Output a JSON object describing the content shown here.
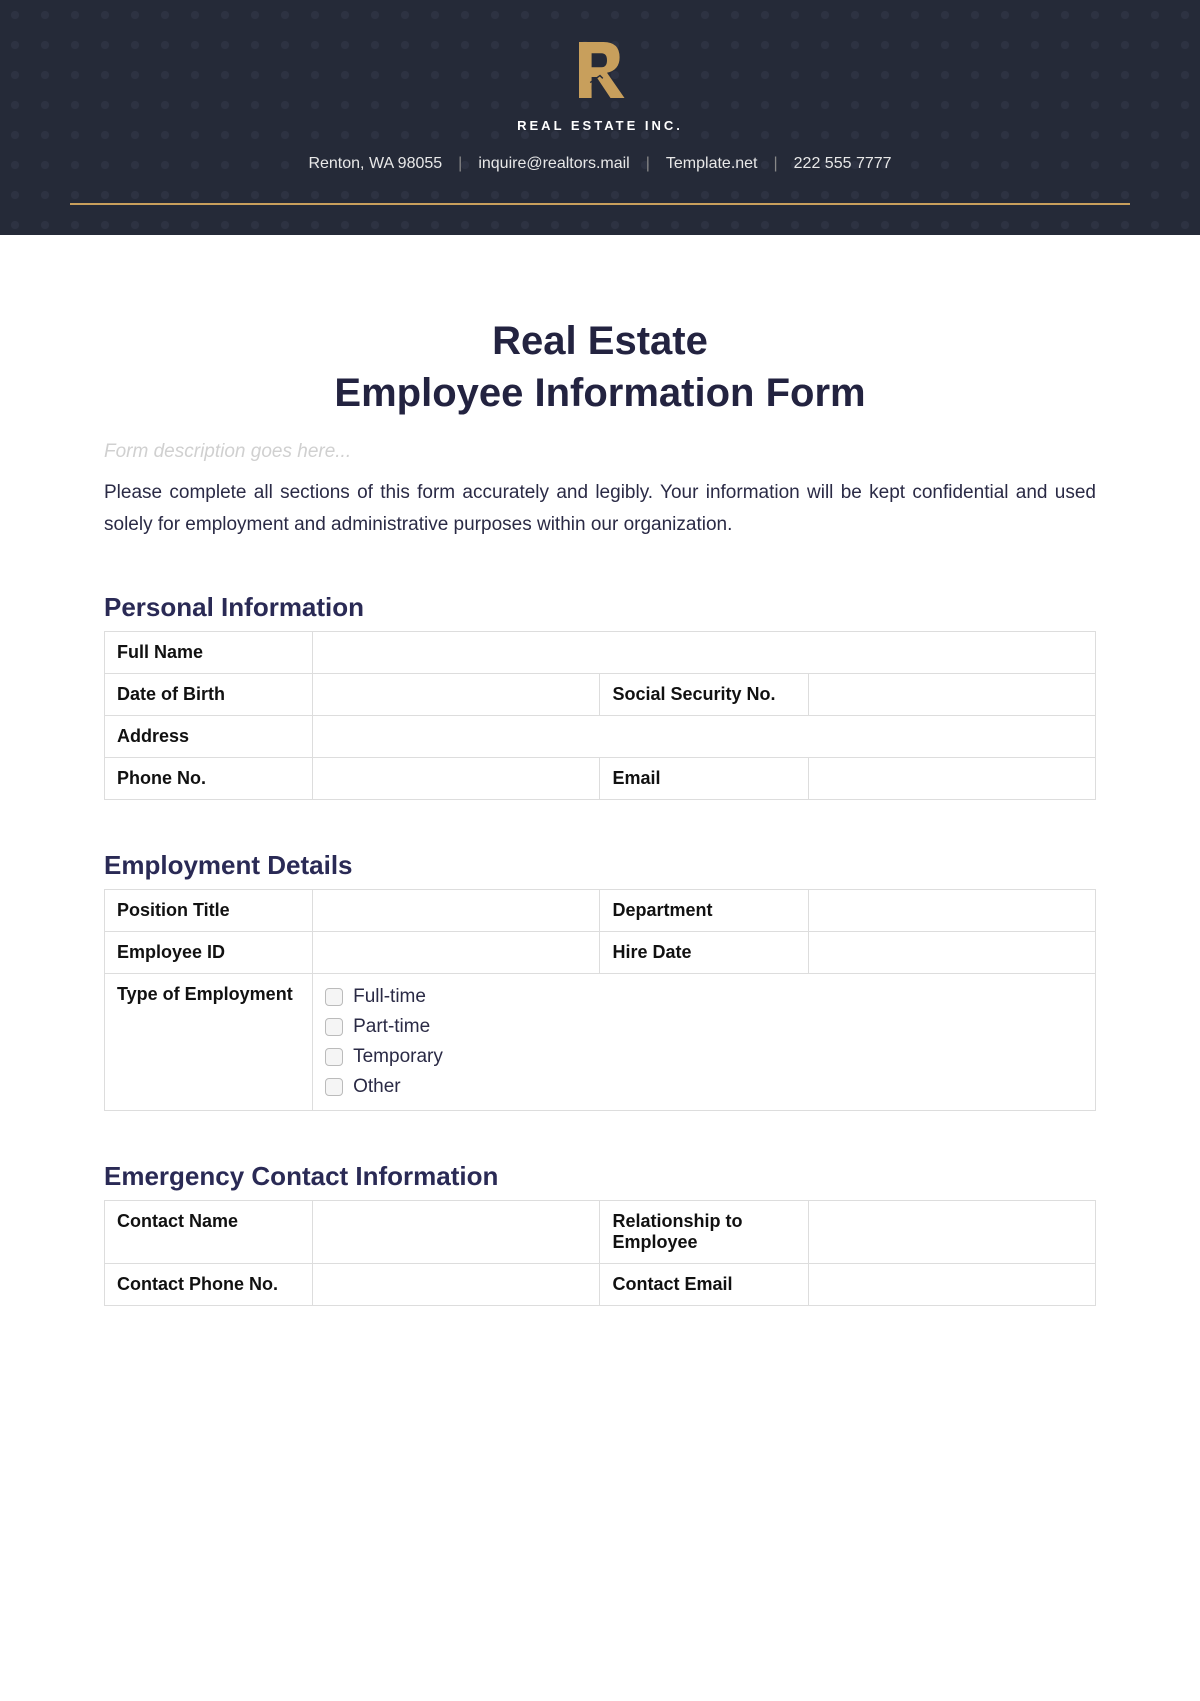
{
  "header": {
    "brand": "REAL ESTATE INC.",
    "address": "Renton, WA 98055",
    "email": "inquire@realtors.mail",
    "website": "Template.net",
    "phone": "222 555 7777"
  },
  "form": {
    "title_line1": "Real Estate",
    "title_line2": "Employee Information Form",
    "description_placeholder": "Form description goes here...",
    "instructions": "Please complete all sections of this form accurately and legibly. Your information will be kept confidential and used solely for employment and administrative purposes within our organization."
  },
  "sections": {
    "personal": {
      "title": "Personal Information",
      "fields": {
        "full_name": "Full Name",
        "dob": "Date of Birth",
        "ssn": "Social Security No.",
        "address": "Address",
        "phone": "Phone No.",
        "email": "Email"
      }
    },
    "employment": {
      "title": "Employment Details",
      "fields": {
        "position": "Position Title",
        "department": "Department",
        "employee_id": "Employee ID",
        "hire_date": "Hire Date",
        "type": "Type of Employment"
      },
      "employment_types": [
        "Full-time",
        "Part-time",
        "Temporary",
        "Other"
      ]
    },
    "emergency": {
      "title": "Emergency Contact Information",
      "fields": {
        "contact_name": "Contact Name",
        "relationship": "Relationship to Employee",
        "contact_phone": "Contact Phone No.",
        "contact_email": "Contact Email"
      }
    }
  }
}
